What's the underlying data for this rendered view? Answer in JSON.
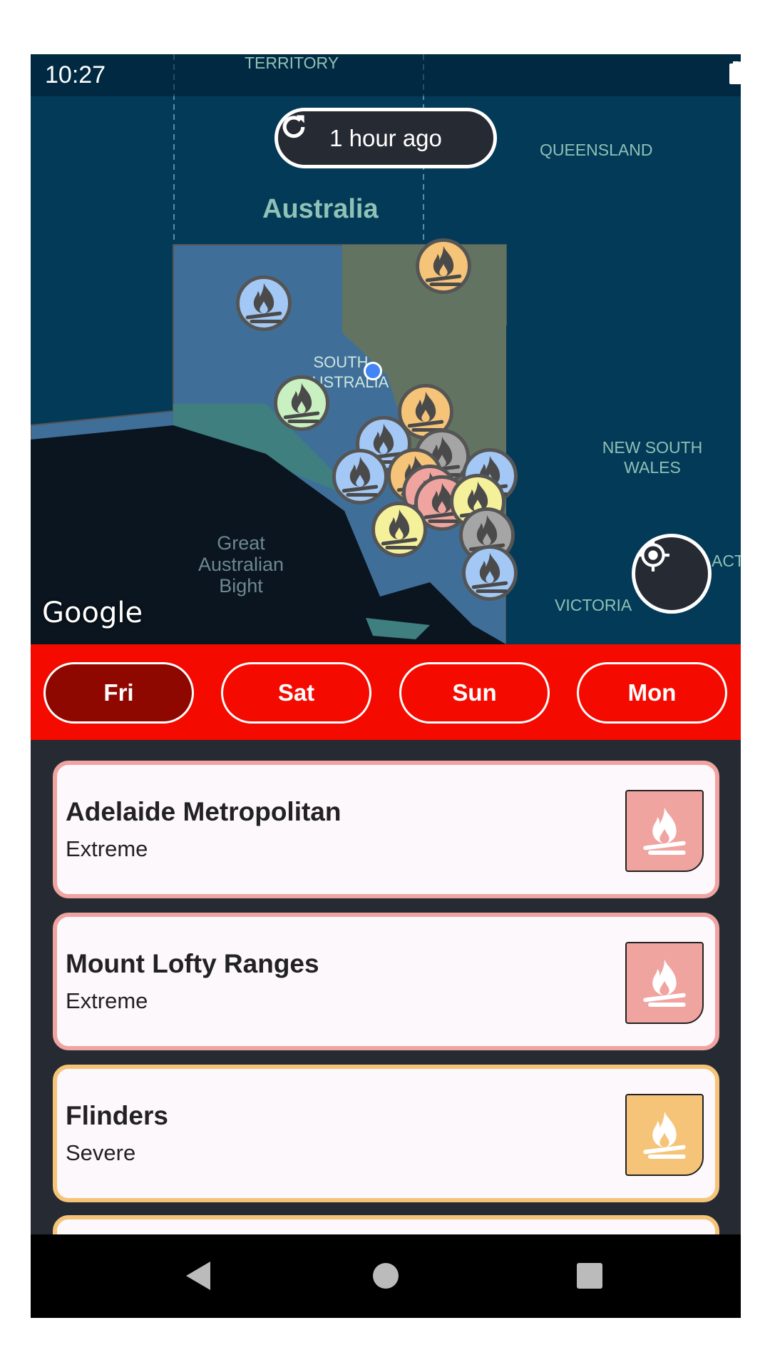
{
  "status_bar": {
    "time": "10:27",
    "icons": [
      "location-pin-icon",
      "wifi-icon",
      "signal-icon",
      "battery-icon"
    ]
  },
  "map": {
    "refresh_label": "1 hour ago",
    "labels": {
      "territory": "TERRITORY",
      "queensland": "QUEENSLAND",
      "australia": "Australia",
      "south_australia": "SOUTH AUSTRALIA",
      "nsw": "NEW SOUTH WALES",
      "bight": "Great Australian Bight",
      "victoria": "VICTORIA",
      "act": "ACT"
    },
    "attribution": "Google",
    "marker_colors": {
      "low": "#a3c8f5",
      "moderate": "#c8f0c0",
      "high": "#f5f09a",
      "severe": "#f5c478",
      "extreme": "#f0a4a0",
      "none": "#a5a5a5"
    }
  },
  "days": [
    {
      "label": "Fri",
      "active": true
    },
    {
      "label": "Sat",
      "active": false
    },
    {
      "label": "Sun",
      "active": false
    },
    {
      "label": "Mon",
      "active": false
    }
  ],
  "districts": [
    {
      "name": "Adelaide Metropolitan",
      "rating": "Extreme",
      "color": "#f0a4a0"
    },
    {
      "name": "Mount Lofty Ranges",
      "rating": "Extreme",
      "color": "#f0a4a0"
    },
    {
      "name": "Flinders",
      "rating": "Severe",
      "color": "#f5c478"
    }
  ]
}
